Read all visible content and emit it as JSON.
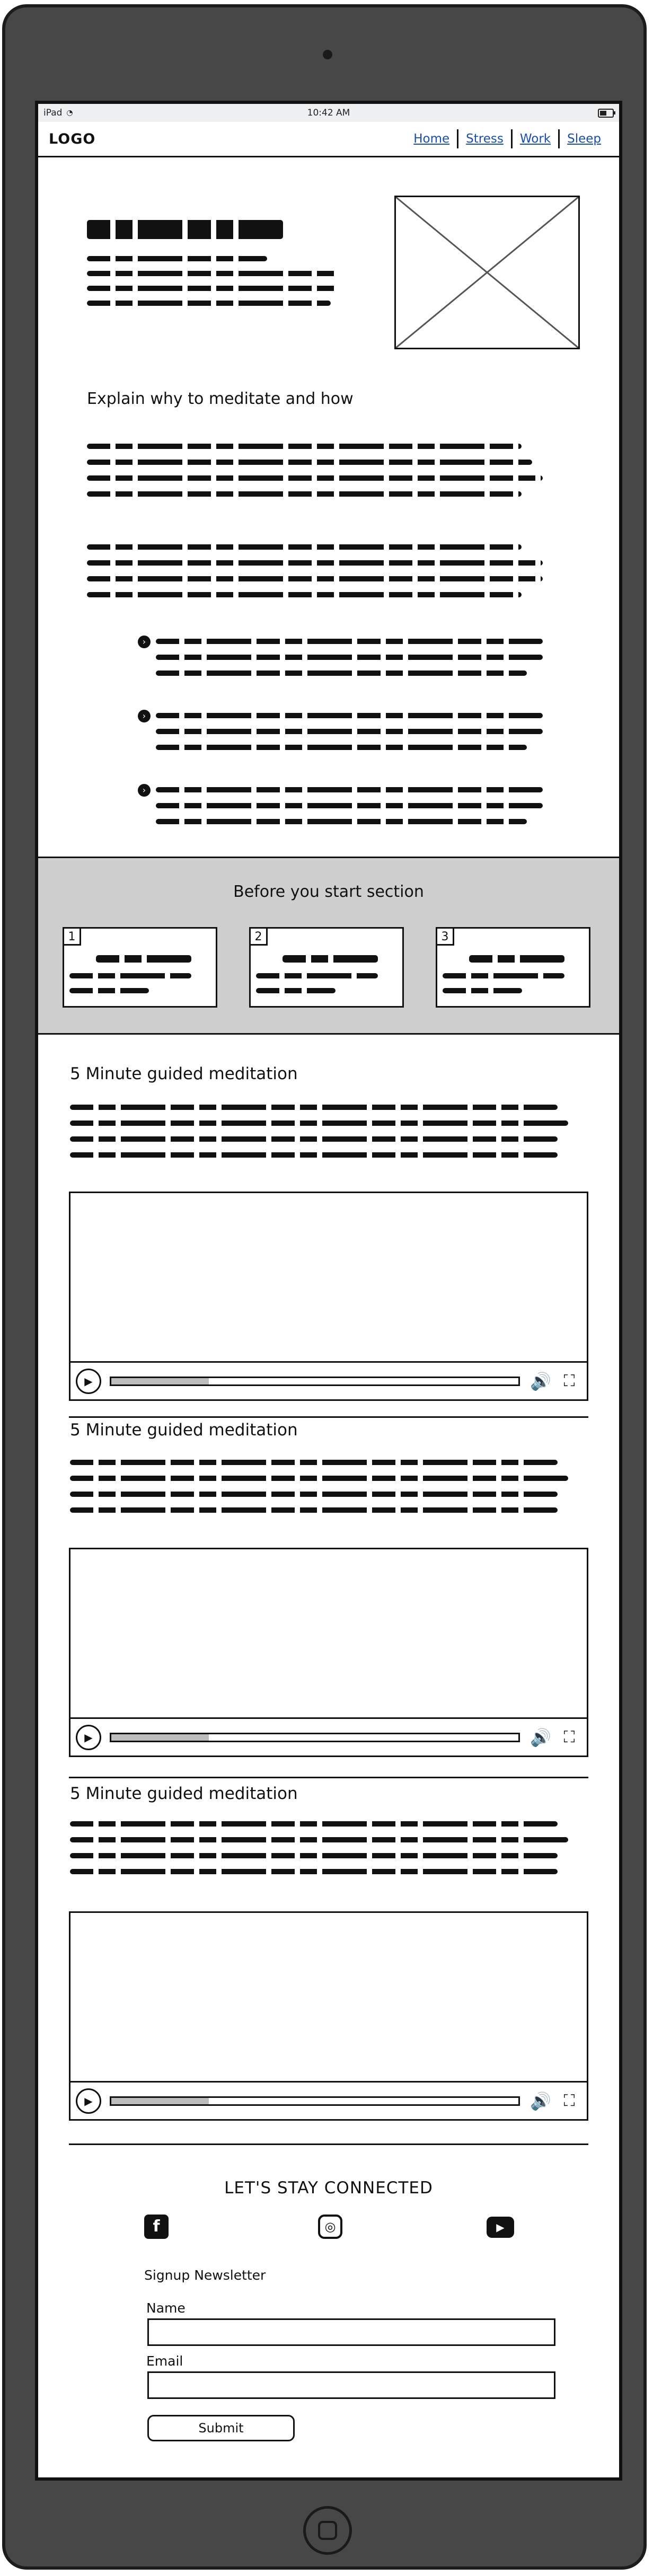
{
  "device": {
    "name": "iPad",
    "time": "10:42 AM"
  },
  "nav": {
    "logo": "LOGO",
    "links": [
      "Home",
      "Stress",
      "Work",
      "Sleep"
    ]
  },
  "hero": {
    "subheading": "Explain why to meditate and how"
  },
  "before_section": {
    "title": "Before you start section",
    "cards": [
      {
        "number": "1"
      },
      {
        "number": "2"
      },
      {
        "number": "3"
      }
    ]
  },
  "meditations": [
    {
      "title": "5 Minute guided meditation",
      "progress": 0.24
    },
    {
      "title": "5 Minute guided meditation",
      "progress": 0.24
    },
    {
      "title": "5 Minute guided meditation",
      "progress": 0.24
    }
  ],
  "footer": {
    "connect_title": "LET'S STAY CONNECTED",
    "social_icons": [
      "facebook-icon",
      "instagram-icon",
      "youtube-icon"
    ],
    "newsletter_title": "Signup Newsletter",
    "name_label": "Name",
    "email_label": "Email",
    "submit_label": "Submit"
  }
}
